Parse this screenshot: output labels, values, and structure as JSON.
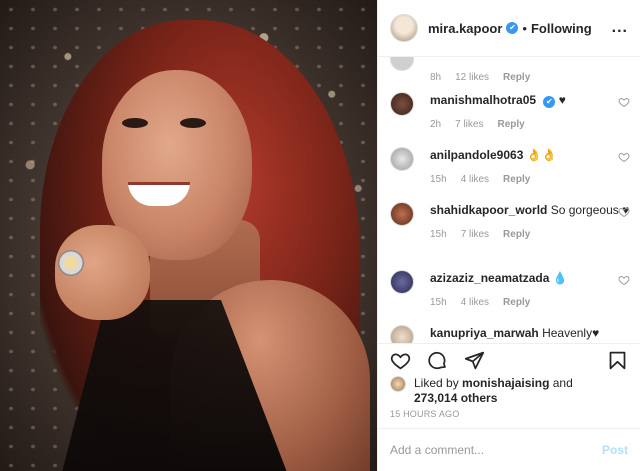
{
  "header": {
    "username": "mira.kapoor",
    "verified_icon": "✔",
    "separator": "•",
    "follow_status": "Following",
    "more_label": "..."
  },
  "comments": [
    {
      "username": "",
      "text": "",
      "time": "8h",
      "likes": "12 likes",
      "reply": "Reply",
      "avatar_color": "#cfcfcf"
    },
    {
      "username": "manishmalhotra05",
      "verified_icon": "✔",
      "text": "♥",
      "time": "2h",
      "likes": "7 likes",
      "reply": "Reply",
      "avatar_color": "#5a3a30"
    },
    {
      "username": "anilpandole9063",
      "text": "👌👌",
      "time": "15h",
      "likes": "4 likes",
      "reply": "Reply",
      "avatar_color": "#bdbdbd"
    },
    {
      "username": "shahidkapoor_world",
      "text": "So gorgeous ♥",
      "time": "15h",
      "likes": "7 likes",
      "reply": "Reply",
      "avatar_color": "#8a3a2a"
    },
    {
      "username": "azizaziz_neamatzada",
      "text": "💧",
      "time": "15h",
      "likes": "4 likes",
      "reply": "Reply",
      "avatar_color": "#4a4a70"
    },
    {
      "username": "kanupriya_marwah",
      "text": "Heavenly♥",
      "avatar_color": "#d8c8b8"
    }
  ],
  "likes": {
    "prefix": "Liked by",
    "user": "monishajaising",
    "conjunction": "and",
    "count": "273,014 others"
  },
  "timestamp": "15 HOURS AGO",
  "add_comment": {
    "placeholder": "Add a comment...",
    "post_label": "Post"
  },
  "colors": {
    "verified": "#3897f0",
    "post_disabled": "#b2dffc",
    "meta_gray": "#999999"
  }
}
